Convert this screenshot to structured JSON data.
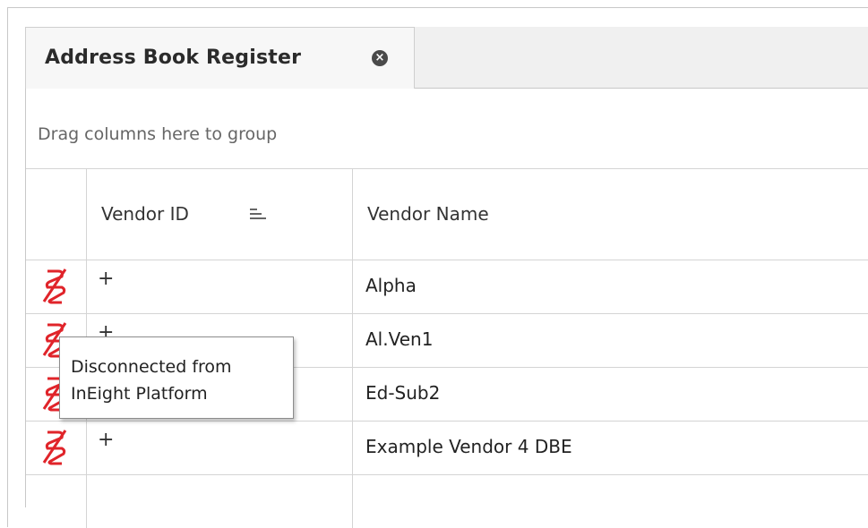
{
  "tab": {
    "title": "Address Book Register",
    "close_icon": "close-icon"
  },
  "grid": {
    "group_hint": "Drag columns here to group",
    "columns": [
      {
        "label": ""
      },
      {
        "label": "Vendor ID",
        "sort_icon": "sort-icon"
      },
      {
        "label": "Vendor Name"
      }
    ],
    "rows": [
      {
        "status_icon": "disconnected-icon",
        "expand": "+",
        "vendor_name": "Alpha"
      },
      {
        "status_icon": "disconnected-icon",
        "expand": "+",
        "vendor_name": "Al.Ven1"
      },
      {
        "status_icon": "disconnected-icon",
        "expand": "+",
        "vendor_name": "Ed-Sub2"
      },
      {
        "status_icon": "disconnected-icon",
        "expand": "+",
        "vendor_name": "Example Vendor 4 DBE"
      }
    ]
  },
  "tooltip": {
    "line1": "Disconnected from",
    "line2": "InEight Platform"
  },
  "colors": {
    "disconnected": "#e0242a",
    "border": "#d4d4d4"
  }
}
